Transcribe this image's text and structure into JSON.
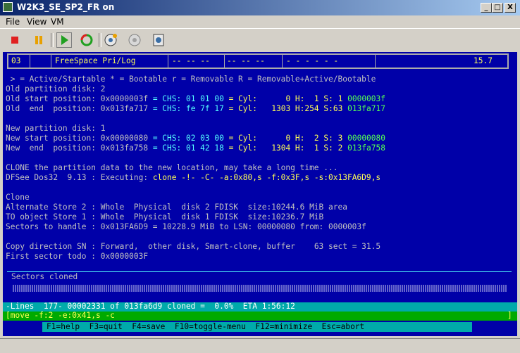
{
  "window": {
    "title": "W2K3_SE_SP2_FR on",
    "controls": [
      "_",
      "□",
      "X"
    ]
  },
  "menu": [
    "File",
    "View",
    "VM"
  ],
  "toolbar": {
    "icons": [
      "stop-icon",
      "pause-icon",
      "play-icon",
      "reset-icon",
      "snapshot-icon",
      "revert-icon",
      "manage-snapshots-icon"
    ],
    "colors": {
      "stop": "#e02020",
      "pause": "#e8a000",
      "play": "#20a020"
    }
  },
  "console": {
    "header": {
      "num": "03",
      "name": "FreeSpace Pri/Log",
      "f1": "-- -- --",
      "f2": "-- -- --",
      "f3": "- - - - - -",
      "size": "15.7"
    },
    "legend": " > = Active/Startable * = Bootable r = Removable R = Removable+Active/Bootable",
    "old": {
      "label": "Old partition disk: 2",
      "start": {
        "prefix": "Old start position: ",
        "hex": "0x0000003f",
        "chs_label": " = CHS: ",
        "chs": "01 01 00",
        "cyl_label": " = Cyl:",
        "cyl": "0",
        "h_label": " H:",
        "h": "1",
        "s_label": " S:",
        "s": "1",
        "lsn": "0000003f"
      },
      "end": {
        "prefix": "Old  end  position: ",
        "hex": "0x013fa717",
        "chs_label": " = CHS: ",
        "chs": "fe 7f 17",
        "cyl_label": " = Cyl:",
        "cyl": "1303",
        "h_label": " H:",
        "h": "254",
        "s_label": " S:",
        "s": "63",
        "lsn": "013fa717"
      }
    },
    "new": {
      "label": "New partition disk: 1",
      "start": {
        "prefix": "New start position: ",
        "hex": "0x00000080",
        "chs_label": " = CHS: ",
        "chs": "02 03 00",
        "cyl_label": " = Cyl:",
        "cyl": "0",
        "h_label": " H:",
        "h": "2",
        "s_label": " S:",
        "s": "3",
        "lsn": "00000080"
      },
      "end": {
        "prefix": "New  end  position: ",
        "hex": "0x013fa758",
        "chs_label": " = CHS: ",
        "chs": "01 42 18",
        "cyl_label": " = Cyl:",
        "cyl": "1304",
        "h_label": " H:",
        "h": "1",
        "s_label": " S:",
        "s": "2",
        "lsn": "013fa758"
      }
    },
    "clone_msg": "CLONE the partition data to the new location, may take a long time ...",
    "dfsee_prefix": "DFSee Dos32  9.13 : Executing: ",
    "dfsee_cmd": "clone -!- -C- -a:0x80,s -f:0x3F,s -s:0x13FA6D9,s",
    "clone_title": "Clone",
    "alt_store": "Alternate Store 2 : Whole  Physical  disk 2 FDISK  size:10244.6 MiB area",
    "to_store": "TO object Store 1 : Whole  Physical  disk 1 FDISK  size:10236.7 MiB",
    "sectors_handle": "Sectors to handle : 0x013FA6D9 = 10228.9 MiB to LSN: 00000080 from: 0000003f",
    "copy_dir_prefix": "Copy direction SN : Forward,  other disk, Smart-clone, buffer",
    "copy_dir_buf": "    63 sect = 31.5",
    "first_sector": "First sector todo : 0x0000003F",
    "sectors_cloned": "Sectors cloned",
    "status": "-Lines  177- 00002331 of 013fa6d9 cloned =  0.0%  ETA 1:56:12",
    "command": "[move -f:2 -e:0x41,s -c",
    "command_end": "]",
    "keys": "F1=help  F3=quit  F4=save  F10=toggle-menu  F12=minimize  Esc=abort"
  }
}
